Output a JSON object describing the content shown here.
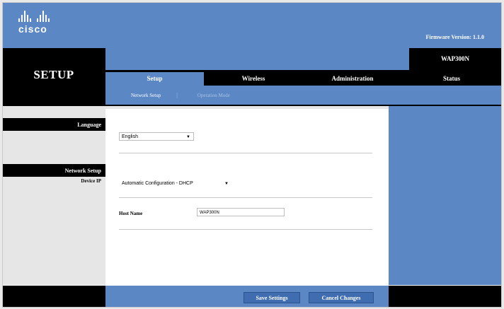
{
  "header": {
    "logo_text": "cisco",
    "firmware_version": "Firmware Version: 1.1.0",
    "section_title": "SETUP",
    "model": "WAP300N"
  },
  "tabs": [
    {
      "label": "Setup",
      "active": true
    },
    {
      "label": "Wireless",
      "active": false
    },
    {
      "label": "Administration",
      "active": false
    },
    {
      "label": "Status",
      "active": false
    }
  ],
  "subtabs": [
    {
      "label": "Network Setup",
      "active": true
    },
    {
      "label": "Operation Mode",
      "active": false
    }
  ],
  "sidebar": {
    "language_heading": "Language",
    "network_heading": "Network Setup",
    "device_ip_label": "Device IP"
  },
  "form": {
    "language_value": "English",
    "ip_config_value": "Automatic Configuration - DHCP",
    "host_name_label": "Host Name",
    "host_name_value": "WAP300N"
  },
  "buttons": {
    "save": "Save Settings",
    "cancel": "Cancel Changes"
  },
  "colors": {
    "brand_blue": "#5b87c4",
    "black": "#000000"
  }
}
